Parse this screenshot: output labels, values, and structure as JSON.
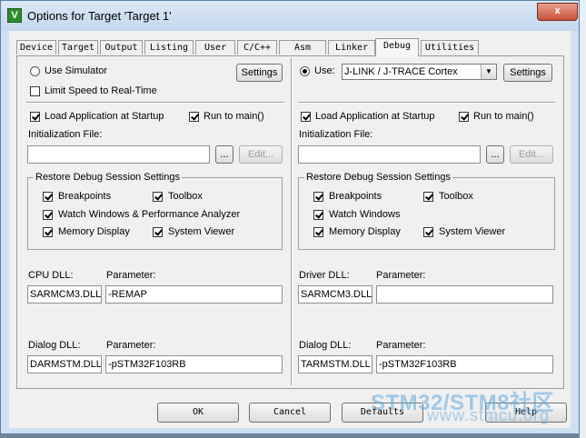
{
  "window": {
    "title": "Options for Target 'Target 1'",
    "close_label": "x"
  },
  "tabs": [
    {
      "label": "Device"
    },
    {
      "label": "Target"
    },
    {
      "label": "Output"
    },
    {
      "label": "Listing"
    },
    {
      "label": "User"
    },
    {
      "label": "C/C++"
    },
    {
      "label": "Asm"
    },
    {
      "label": "Linker"
    },
    {
      "label": "Debug",
      "active": true
    },
    {
      "label": "Utilities"
    }
  ],
  "left": {
    "use_simulator_label": "Use Simulator",
    "use_simulator_selected": false,
    "limit_speed_label": "Limit Speed to Real-Time",
    "limit_speed_checked": false,
    "settings_label": "Settings",
    "load_app_label": "Load Application at Startup",
    "run_to_main_label": "Run to main()",
    "init_file_label": "Initialization File:",
    "init_file_value": "",
    "browse_label": "...",
    "edit_label": "Edit...",
    "restore_group_label": "Restore Debug Session Settings",
    "breakpoints_label": "Breakpoints",
    "toolbox_label": "Toolbox",
    "watch_label": "Watch Windows & Performance Analyzer",
    "memory_label": "Memory Display",
    "system_viewer_label": "System Viewer",
    "cpu_dll_label": "CPU DLL:",
    "cpu_dll_value": "SARMCM3.DLL",
    "cpu_param_label": "Parameter:",
    "cpu_param_value": "-REMAP",
    "dialog_dll_label": "Dialog DLL:",
    "dialog_dll_value": "DARMSTM.DLL",
    "dialog_param_label": "Parameter:",
    "dialog_param_value": "-pSTM32F103RB"
  },
  "right": {
    "use_label": "Use:",
    "use_selected": true,
    "driver_select_value": "J-LINK / J-TRACE Cortex",
    "settings_label": "Settings",
    "load_app_label": "Load Application at Startup",
    "run_to_main_label": "Run to main()",
    "init_file_label": "Initialization File:",
    "init_file_value": "",
    "browse_label": "...",
    "edit_label": "Edit...",
    "restore_group_label": "Restore Debug Session Settings",
    "breakpoints_label": "Breakpoints",
    "toolbox_label": "Toolbox",
    "watch_label": "Watch Windows",
    "memory_label": "Memory Display",
    "system_viewer_label": "System Viewer",
    "driver_dll_label": "Driver DLL:",
    "driver_dll_value": "SARMCM3.DLL",
    "driver_param_label": "Parameter:",
    "driver_param_value": "",
    "dialog_dll_label": "Dialog DLL:",
    "dialog_dll_value": "TARMSTM.DLL",
    "dialog_param_label": "Parameter:",
    "dialog_param_value": "-pSTM32F103RB"
  },
  "buttons": {
    "ok": "OK",
    "cancel": "Cancel",
    "defaults": "Defaults",
    "help": "Help"
  },
  "watermark": {
    "line1": "STM32/STM8社区",
    "line2": "www.stmcu.org"
  }
}
